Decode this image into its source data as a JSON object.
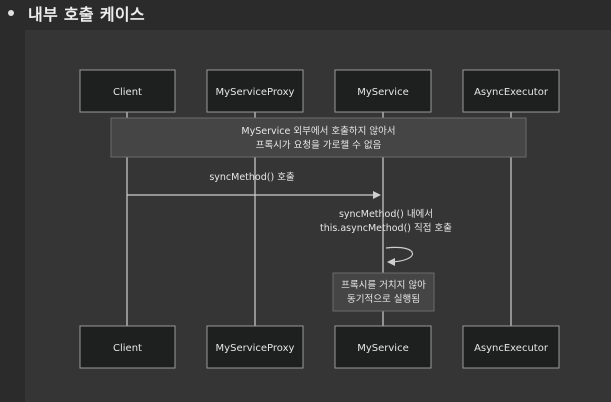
{
  "heading": "내부 호출 케이스",
  "participants": [
    "Client",
    "MyServiceProxy",
    "MyService",
    "AsyncExecutor"
  ],
  "notes": {
    "top": [
      "MyService 외부에서 호출하지 않아서",
      "프록시가 요청을 가로챌 수 없음"
    ],
    "bottom": [
      "프록시를 거치지 않아",
      "동기적으로 실행됨"
    ]
  },
  "messages": {
    "sync_call": "syncMethod() 호출",
    "self_call": [
      "syncMethod() 내에서",
      "this.asyncMethod() 직접 호출"
    ]
  },
  "colors": {
    "page_bg": "#2b2b2b",
    "panel_bg": "#353535",
    "box_fill": "#1e1f1f",
    "box_stroke": "#9a9a9a",
    "line": "#cfcfcf",
    "note_fill": "#454545",
    "text": "#e6e6e6"
  }
}
